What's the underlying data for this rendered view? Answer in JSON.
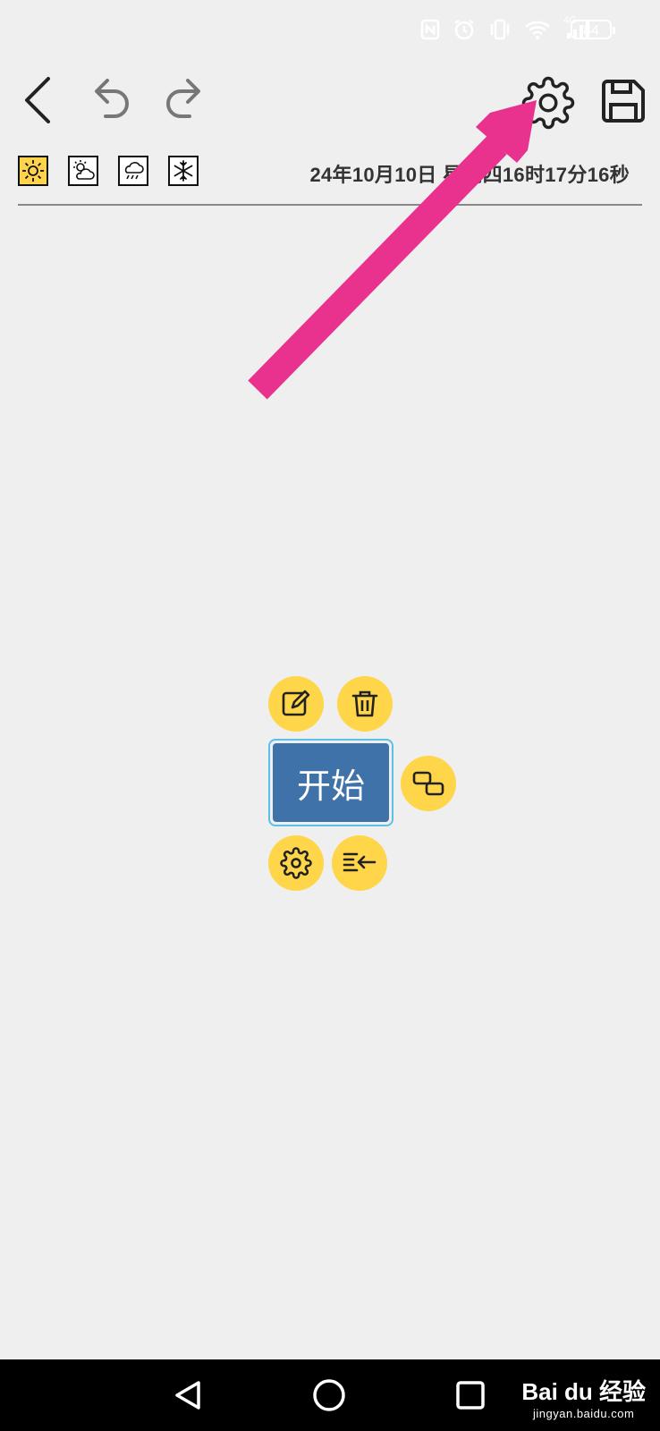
{
  "status_bar": {
    "battery": "84",
    "network": "4G"
  },
  "toolbar": {
    "back_icon": "chevron-left-icon",
    "undo_icon": "undo-icon",
    "redo_icon": "redo-icon",
    "settings_icon": "gear-icon",
    "save_icon": "save-icon"
  },
  "weather": {
    "items": [
      {
        "icon": "sun-icon",
        "active": true
      },
      {
        "icon": "cloudy-sun-icon",
        "active": false
      },
      {
        "icon": "rain-icon",
        "active": false
      },
      {
        "icon": "snowflake-icon",
        "active": false
      }
    ],
    "datetime": "24年10月10日 星期四16时17分16秒"
  },
  "canvas": {
    "node_label": "开始",
    "actions": [
      "edit-icon",
      "trash-icon",
      "link-node-icon",
      "gear-icon",
      "outdent-icon"
    ]
  },
  "watermark": {
    "brand": "Bai du 经验",
    "url": "jingyan.baidu.com"
  },
  "colors": {
    "background": "#efefef",
    "node_fill": "#3f72a8",
    "node_border": "#5bc0e8",
    "action_yellow": "#ffd54a",
    "arrow_pink": "#e9318e"
  }
}
